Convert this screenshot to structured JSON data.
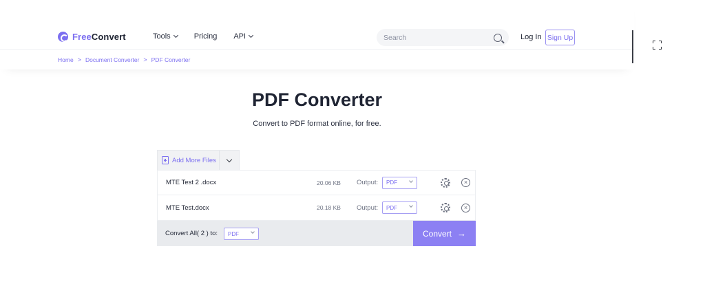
{
  "header": {
    "logo": {
      "part1": "Free",
      "part2": "Convert"
    },
    "nav": [
      {
        "label": "Tools",
        "has_dropdown": true
      },
      {
        "label": "Pricing",
        "has_dropdown": false
      },
      {
        "label": "API",
        "has_dropdown": true
      }
    ],
    "search": {
      "placeholder": "Search"
    },
    "login_label": "Log In",
    "signup_label": "Sign Up"
  },
  "breadcrumb": {
    "items": [
      "Home",
      "Document Converter",
      "PDF Converter"
    ],
    "separator": ">"
  },
  "hero": {
    "title": "PDF Converter",
    "subtitle": "Convert to PDF format online, for free."
  },
  "converter": {
    "add_files_label": "Add More Files",
    "files": [
      {
        "name": "MTE Test 2 .docx",
        "size": "20.06 KB",
        "output_label": "Output:",
        "output_format": "PDF"
      },
      {
        "name": "MTE Test.docx",
        "size": "20.18 KB",
        "output_label": "Output:",
        "output_format": "PDF"
      }
    ],
    "convert_all_label": "Convert All( 2 ) to:",
    "convert_all_format": "PDF",
    "convert_button_label": "Convert",
    "arrow": "→",
    "close_glyph": "×"
  },
  "colors": {
    "brand": "#7c6ff0",
    "convert_button": "#8c80f3",
    "bottom_bar": "#e9ebee"
  }
}
